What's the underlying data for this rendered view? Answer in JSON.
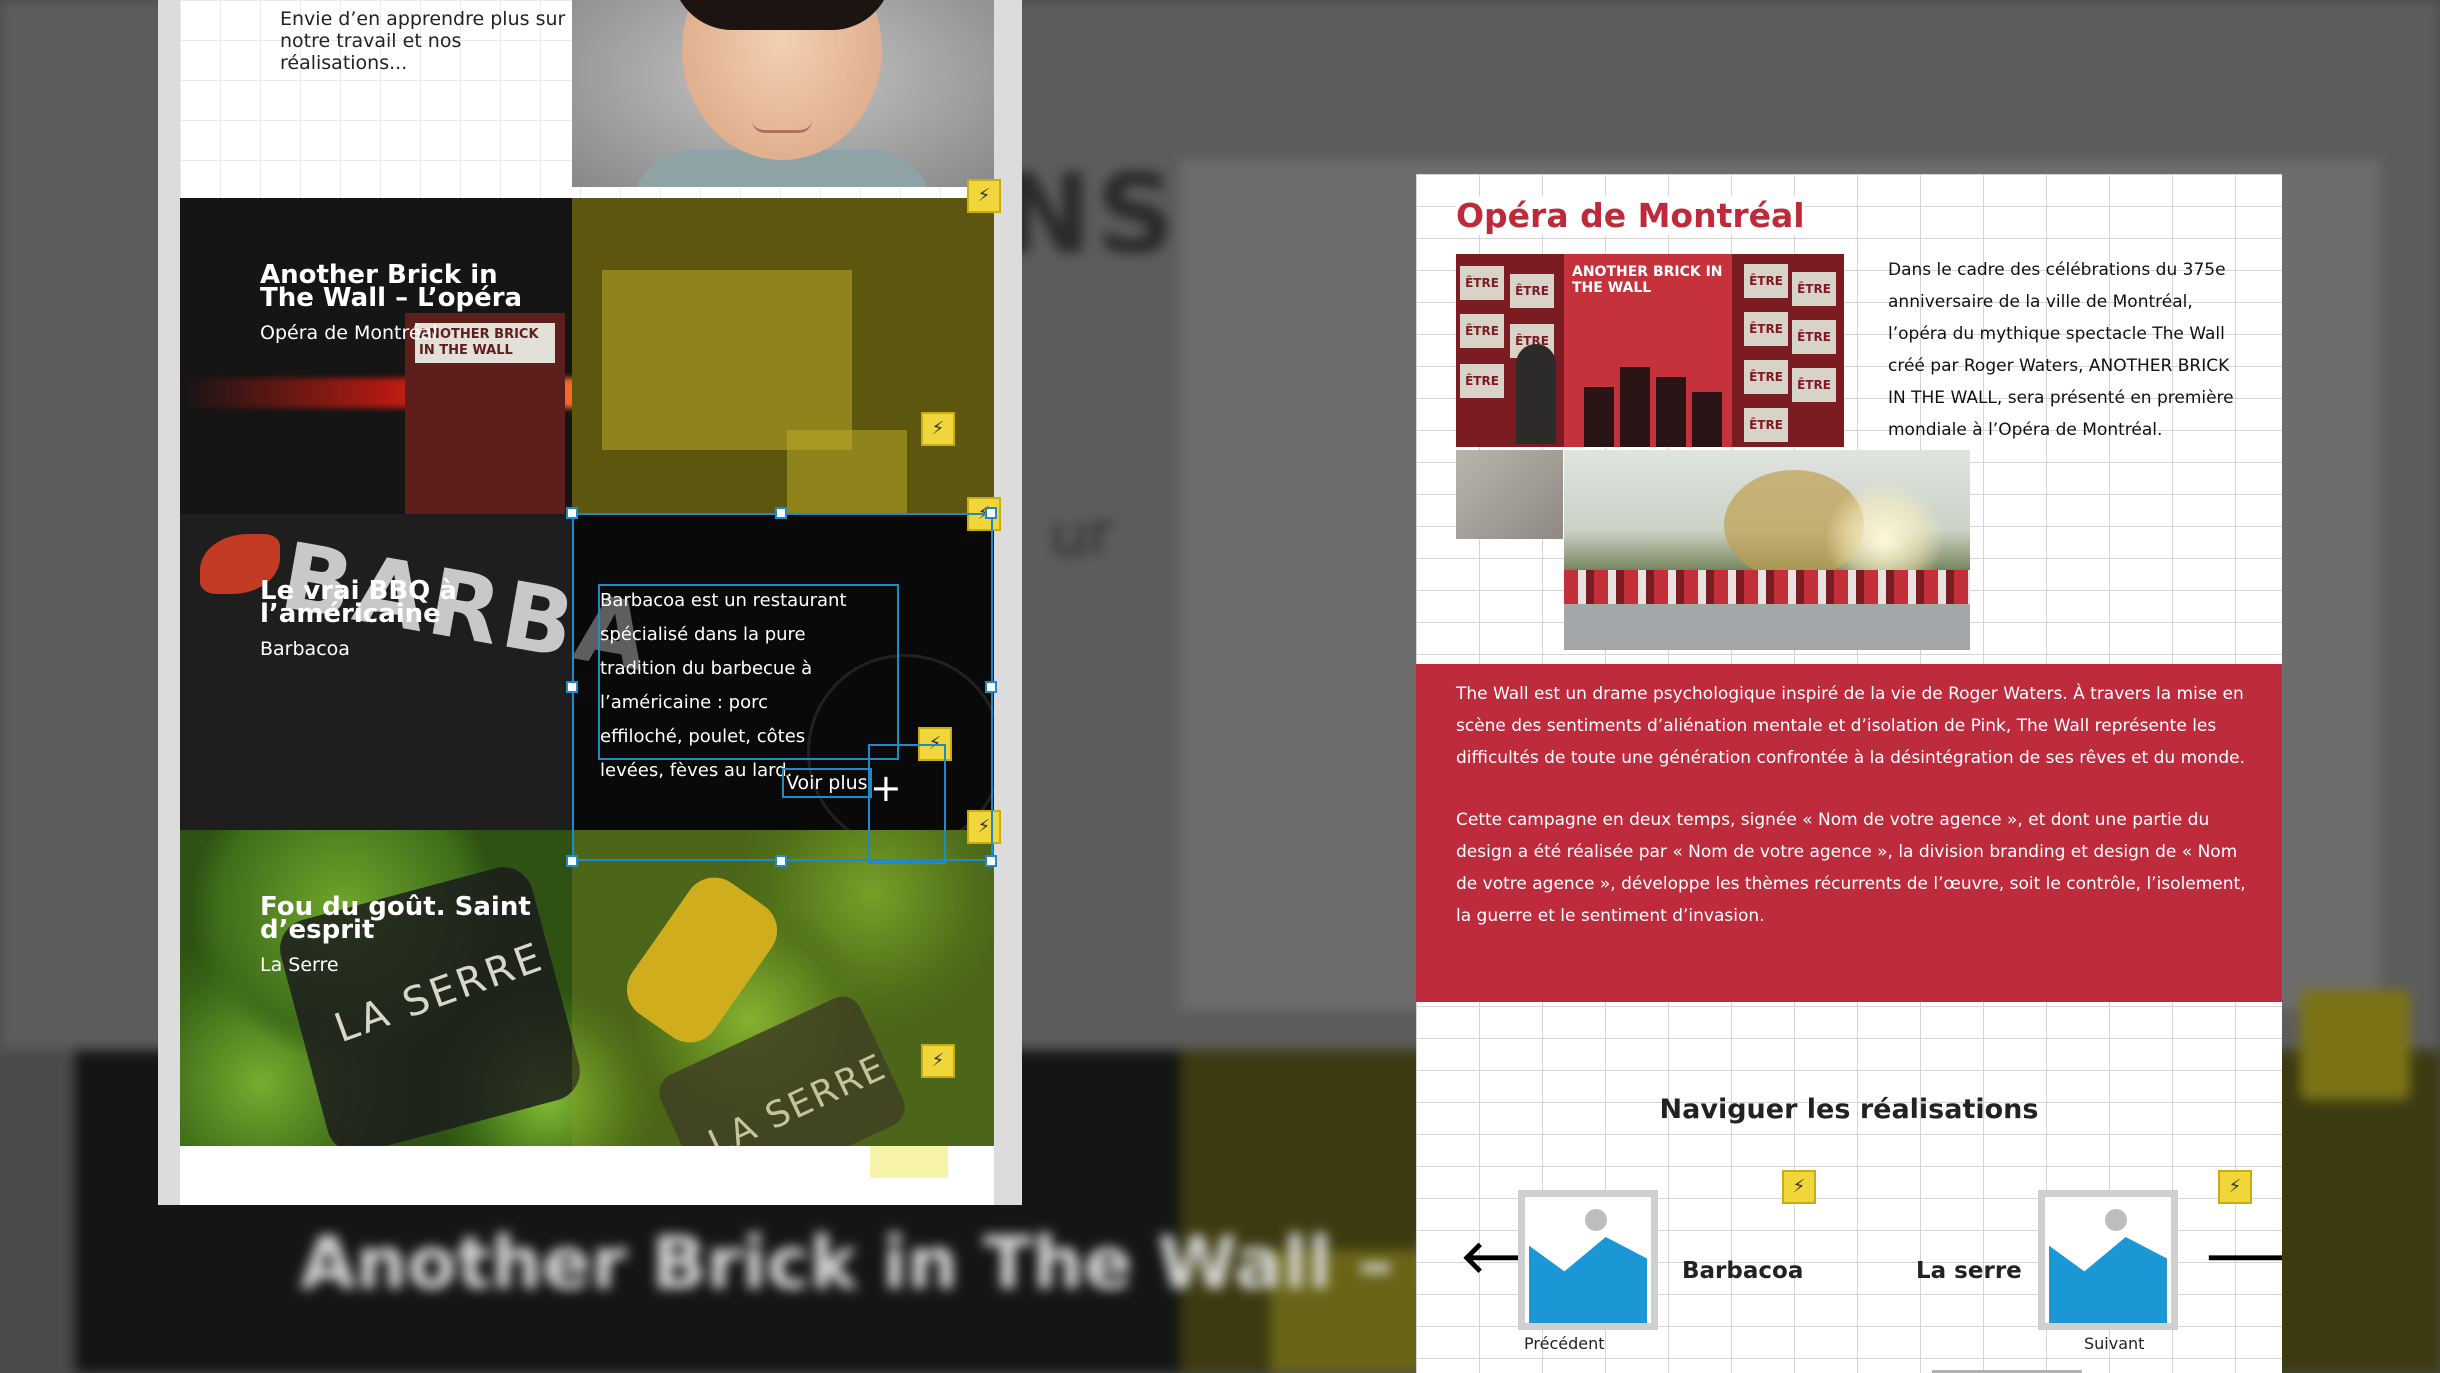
{
  "left_panel": {
    "intro_text": "Envie d’en apprendre plus sur notre travail et nos réalisations...",
    "projects": [
      {
        "title": "Another Brick in The Wall – L’opéra",
        "client": "Opéra de Montréal"
      },
      {
        "title": "Le vrai BBQ à l’américaine",
        "client": "Barbacoa"
      },
      {
        "title": "Fou du goût. Saint d’esprit",
        "client": "La Serre"
      }
    ],
    "hover_description": "Barbacoa est un restaurant spécialisé dans la pure tradition du barbecue à l’américaine : porc effiloché, poulet, côtes levées, fèves au lard.",
    "voir_plus_label": "Voir plus",
    "image_text": {
      "poster": "ANOTHER BRICK IN THE WALL",
      "sign": "BARBA",
      "jar": "LA SERRE"
    }
  },
  "right_panel": {
    "title": "Opéra de Montréal",
    "description": "Dans le cadre des célébrations du 375e anniversaire de la ville de Montréal, l’opéra du mythique spectacle The Wall créé par Roger Waters, ANOTHER BRICK IN THE WALL, sera présenté en première mondiale à l’Opéra de Montréal.",
    "poster_title": "ANOTHER BRICK IN THE WALL",
    "poster_tile_label": "ÊTRE",
    "red_paragraphs": [
      "The Wall est un drame psychologique inspiré de la vie de Roger Waters. À travers la mise en scène des sentiments d’aliénation mentale et d’isolation de Pink, The Wall représente les difficultés de toute une génération confrontée à la désintégration de ses rêves et du monde.",
      "Cette campagne en deux temps, signée « Nom de votre agence », et dont une partie du design a été réalisée par « Nom de votre agence », la division branding et design de « Nom de votre agence », développe les thèmes récurrents de l’œuvre, soit le contrôle, l’isolement, la guerre et le sentiment d’invasion."
    ],
    "nav": {
      "title": "Naviguer les réalisations",
      "prev_name": "Barbacoa",
      "next_name": "La serre",
      "prev_label": "Précédent",
      "next_label": "Suivant"
    }
  },
  "background": {
    "big_title": "NS",
    "bottom_title": "Another Brick in The Wall – L’opéra",
    "subtitle_fragment": "ur"
  },
  "icons": {
    "bolt": "lightning-bolt-icon",
    "plus": "plus-icon",
    "arrow_left": "arrow-left-icon",
    "arrow_right": "arrow-right-icon",
    "image_placeholder": "image-placeholder-icon"
  },
  "colors": {
    "accent_red": "#be2b3c",
    "title_red": "#bf2a3a",
    "selection_blue": "#1f89c9",
    "bolt_yellow": "#f0d63a",
    "placeholder_blue": "#1b97d6"
  }
}
